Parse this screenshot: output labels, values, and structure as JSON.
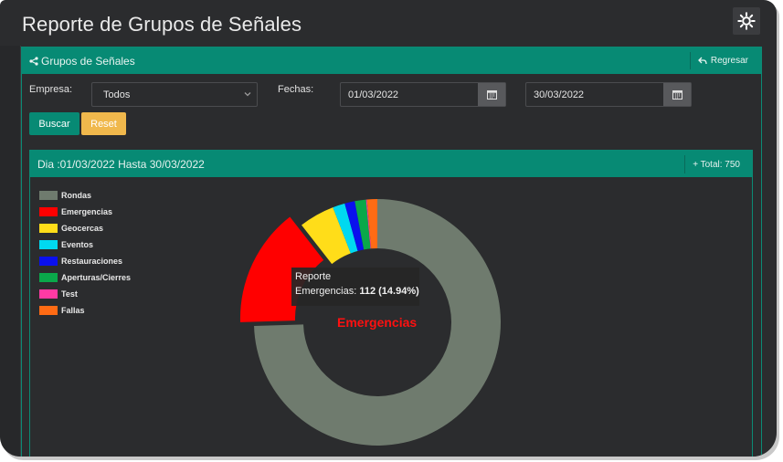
{
  "page": {
    "title": "Reporte de Grupos de Señales"
  },
  "header_panel": {
    "title": "Grupos de Señales",
    "back_label": "Regresar"
  },
  "filters": {
    "empresa_label": "Empresa:",
    "empresa_value": "Todos",
    "fechas_label": "Fechas:",
    "date_from": "01/03/2022",
    "date_to": "30/03/2022",
    "search_label": "Buscar",
    "reset_label": "Reset"
  },
  "chart_panel": {
    "range_text": "Dia :01/03/2022 Hasta 30/03/2022",
    "total_text": "+ Total: 750"
  },
  "tooltip": {
    "title": "Reporte",
    "label": "Emergencias:",
    "value": "112 (14.94%)"
  },
  "center_label": "Emergencias",
  "colors": {
    "accent": "#078a74",
    "reset": "#f0b84c",
    "background": "#2b2c2e"
  },
  "icons": {
    "settings": "gear-icon",
    "share": "share-icon",
    "back": "reply-icon",
    "calendar": "calendar-icon",
    "dropdown": "chevron-down-icon"
  },
  "chart_data": {
    "type": "pie",
    "donut": true,
    "legend_position": "top-left",
    "categories": [
      "Rondas",
      "Emergencias",
      "Geocercas",
      "Eventos",
      "Restauraciones",
      "Aperturas/Cierres",
      "Test",
      "Fallas"
    ],
    "values": [
      559,
      112,
      35,
      12,
      10,
      11,
      1,
      10
    ],
    "colors": [
      "#6f7b6e",
      "#ff0000",
      "#ffdd19",
      "#00d9f0",
      "#0a10ee",
      "#0aa84a",
      "#ff3aa4",
      "#ff6b14"
    ],
    "highlighted": "Emergencias",
    "total": 750
  }
}
